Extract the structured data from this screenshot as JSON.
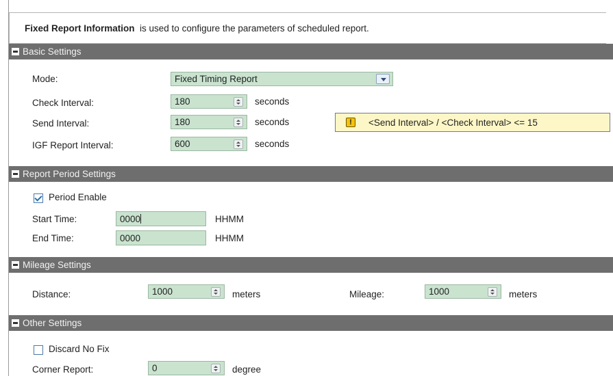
{
  "info": {
    "title_bold": "Fixed Report Information",
    "title_rest": "is used to configure the parameters of scheduled report."
  },
  "basic": {
    "header": "Basic Settings",
    "mode_label": "Mode:",
    "mode_value": "Fixed Timing Report",
    "check_label": "Check Interval:",
    "check_value": "180",
    "check_unit": "seconds",
    "send_label": "Send Interval:",
    "send_value": "180",
    "send_unit": "seconds",
    "igf_label": "IGF Report Interval:",
    "igf_value": "600",
    "igf_unit": "seconds",
    "warning": "<Send Interval> / <Check Interval> <= 15",
    "warning_icon": "!"
  },
  "period": {
    "header": "Report Period Settings",
    "enable_label": "Period Enable",
    "enable_checked": true,
    "start_label": "Start Time:",
    "start_value": "0000",
    "start_unit": "HHMM",
    "end_label": "End Time:",
    "end_value": "0000",
    "end_unit": "HHMM"
  },
  "mileage": {
    "header": "Mileage Settings",
    "distance_label": "Distance:",
    "distance_value": "1000",
    "distance_unit": "meters",
    "mileage_label": "Mileage:",
    "mileage_value": "1000",
    "mileage_unit": "meters"
  },
  "other": {
    "header": "Other Settings",
    "discard_label": "Discard No Fix",
    "discard_checked": false,
    "corner_label": "Corner Report:",
    "corner_value": "0",
    "corner_unit": "degree"
  },
  "colors": {
    "section_header_bg": "#6e6e6e",
    "field_bg": "#c9e3cf",
    "warning_bg": "#fdf7c7",
    "warning_icon": "#f5c20c"
  }
}
